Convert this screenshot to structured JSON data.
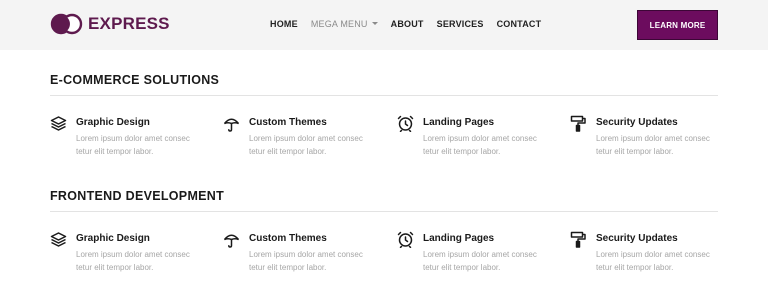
{
  "brand": {
    "name": "EXPRESS",
    "accent": "#6c0c5e"
  },
  "nav": {
    "items": [
      {
        "label": "HOME"
      },
      {
        "label": "MEGA MENU"
      },
      {
        "label": "ABOUT"
      },
      {
        "label": "SERVICES"
      },
      {
        "label": "CONTACT"
      }
    ],
    "cta_label": "LEARN MORE"
  },
  "sections": [
    {
      "title": "E-COMMERCE SOLUTIONS",
      "features": [
        {
          "icon": "layers-icon",
          "title": "Graphic Design",
          "text": "Lorem ipsum dolor amet consec tetur elit tempor labor."
        },
        {
          "icon": "umbrella-icon",
          "title": "Custom Themes",
          "text": "Lorem ipsum dolor amet consec tetur elit tempor labor."
        },
        {
          "icon": "alarm-clock-icon",
          "title": "Landing Pages",
          "text": "Lorem ipsum dolor amet consec tetur elit tempor labor."
        },
        {
          "icon": "paint-roller-icon",
          "title": "Security Updates",
          "text": "Lorem ipsum dolor amet consec tetur elit tempor labor."
        }
      ]
    },
    {
      "title": "FRONTEND DEVELOPMENT",
      "features": [
        {
          "icon": "layers-icon",
          "title": "Graphic Design",
          "text": "Lorem ipsum dolor amet consec tetur elit tempor labor."
        },
        {
          "icon": "umbrella-icon",
          "title": "Custom Themes",
          "text": "Lorem ipsum dolor amet consec tetur elit tempor labor."
        },
        {
          "icon": "alarm-clock-icon",
          "title": "Landing Pages",
          "text": "Lorem ipsum dolor amet consec tetur elit tempor labor."
        },
        {
          "icon": "paint-roller-icon",
          "title": "Security Updates",
          "text": "Lorem ipsum dolor amet consec tetur elit tempor labor."
        }
      ]
    }
  ]
}
